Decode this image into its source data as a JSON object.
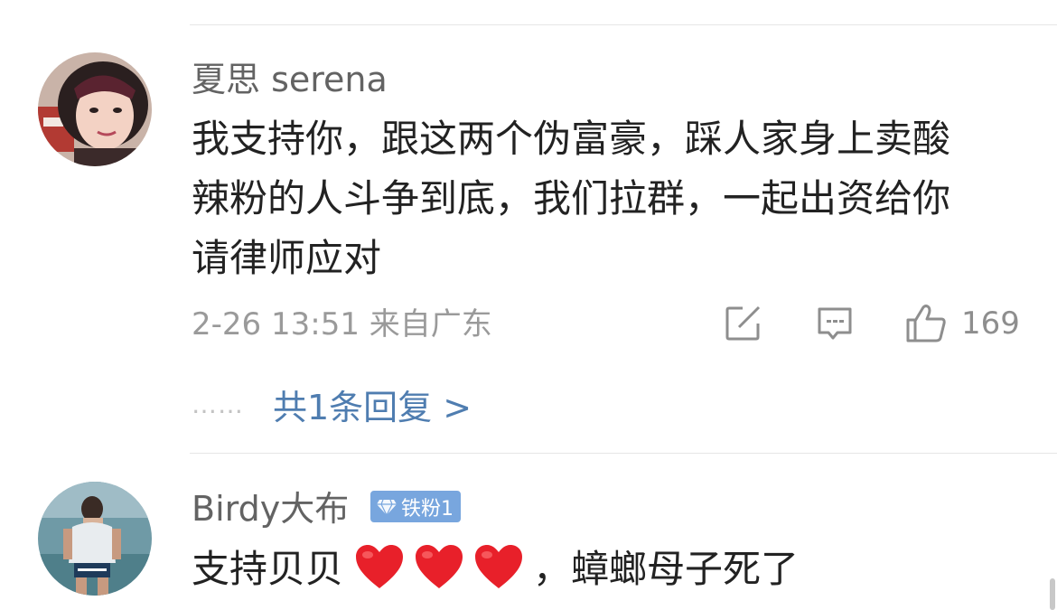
{
  "comments": [
    {
      "username": "夏思 serena",
      "text_lines": [
        "我支持你，跟这两个伪富豪，踩人家身上卖酸",
        "辣粉的人斗争到底，我们拉群，一起出资给你",
        "请律师应对"
      ],
      "meta": "2-26 13:51 来自广东",
      "actions": {
        "share_icon": "share-square-icon",
        "comment_icon": "comment-bubble-icon",
        "like_icon": "thumbs-up-icon",
        "like_count": "169"
      },
      "replies": {
        "dots": "……",
        "label": "共1条回复 >"
      }
    },
    {
      "username": "Birdy大布",
      "badge": "铁粉1",
      "text_before": "支持贝贝",
      "emoji": [
        "red-heart-icon",
        "red-heart-icon",
        "red-heart-icon"
      ],
      "text_after": "，蟑螂母子死了"
    }
  ],
  "colors": {
    "username": "#636363",
    "body_text": "#222222",
    "meta": "#9a9a9a",
    "link": "#4f7db0",
    "badge_bg": "#78a6de",
    "heart": "#e8202a"
  }
}
